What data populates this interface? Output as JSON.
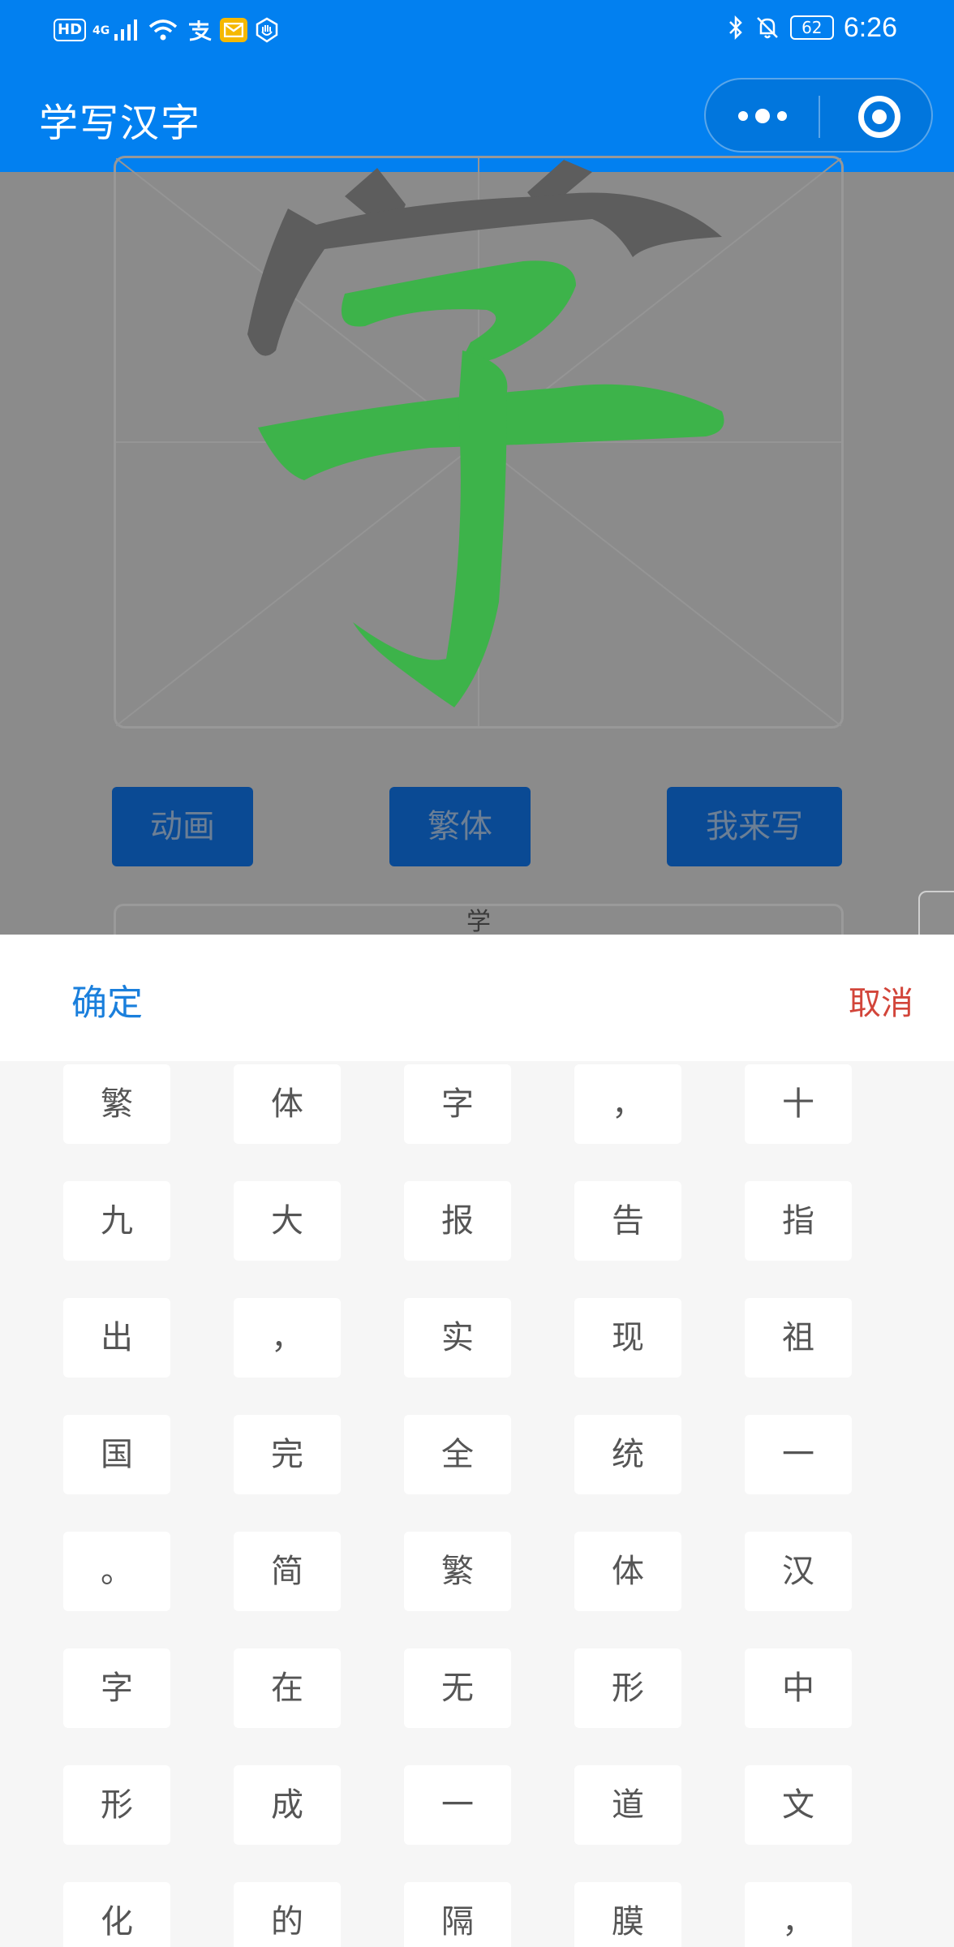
{
  "status_bar": {
    "hd": "HD",
    "network": "4G",
    "battery": "62",
    "time": "6:26",
    "icons": [
      "hd-icon",
      "signal-icon",
      "wifi-icon",
      "alipay-icon",
      "mail-icon",
      "shield-icon",
      "bluetooth-icon",
      "bell-off-icon",
      "battery-icon"
    ]
  },
  "title_bar": {
    "title": "学写汉字",
    "icons": [
      "more-icon",
      "close-miniprogram-icon"
    ]
  },
  "character": {
    "glyph": "字",
    "stroke_color": "#3db34a",
    "shadow_color": "#5d5d5d"
  },
  "buttons": [
    "动画",
    "繁体",
    "我来写"
  ],
  "strip_text": "学",
  "picker": {
    "confirm": "确定",
    "cancel": "取消",
    "items": [
      "繁",
      "体",
      "字",
      "，",
      "十",
      "九",
      "大",
      "报",
      "告",
      "指",
      "出",
      "，",
      "实",
      "现",
      "祖",
      "国",
      "完",
      "全",
      "统",
      "一",
      "。",
      "简",
      "繁",
      "体",
      "汉",
      "字",
      "在",
      "无",
      "形",
      "中",
      "形",
      "成",
      "一",
      "道",
      "文",
      "化",
      "的",
      "隔",
      "膜",
      "，"
    ]
  },
  "colors": {
    "primary": "#0280f0",
    "confirm": "#1a7fdc",
    "cancel": "#d2453a"
  }
}
